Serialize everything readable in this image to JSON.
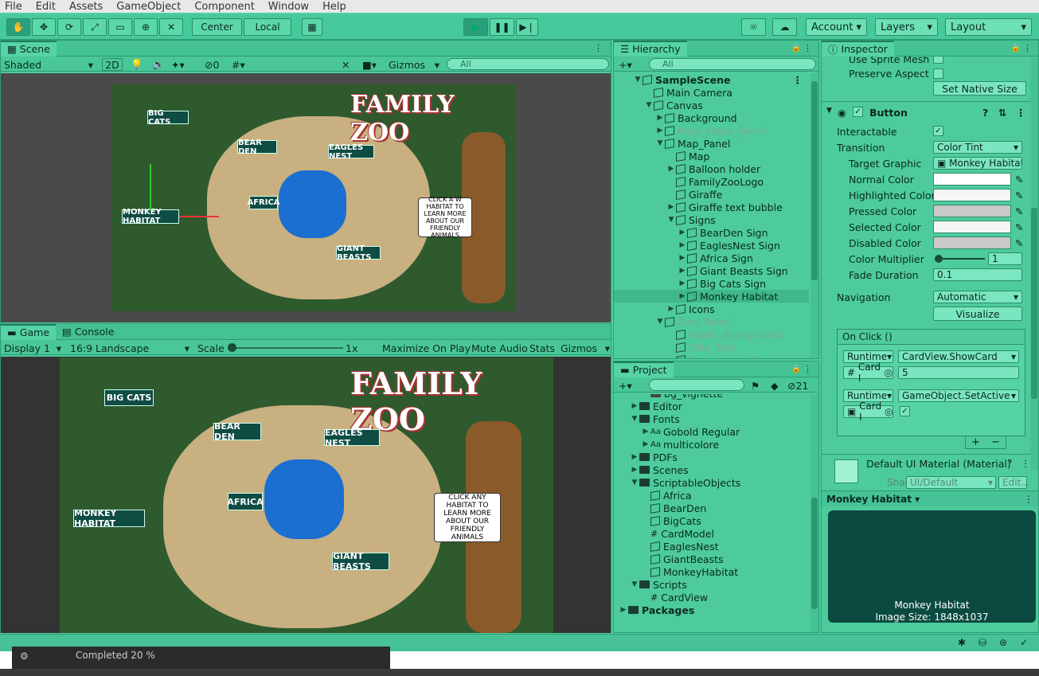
{
  "menu": [
    "File",
    "Edit",
    "Assets",
    "GameObject",
    "Component",
    "Window",
    "Help"
  ],
  "toolbar": {
    "center": "Center",
    "local": "Local",
    "account": "Account",
    "layers": "Layers",
    "layout": "Layout"
  },
  "scene": {
    "tab": "Scene",
    "shading": "Shaded",
    "mode2d": "2D",
    "hidden_count": "0",
    "gizmos": "Gizmos",
    "search_placeholder": "All",
    "map": {
      "title": "FAMILY ZOO",
      "bubble": "CLICK A W HABITAT TO LEARN MORE ABOUT OUR FRIENDLY ANIMALS",
      "signs": [
        "BIG CATS",
        "BEAR DEN",
        "EAGLES NEST",
        "AFRICA",
        "MONKEY HABITAT",
        "GIANT BEASTS"
      ]
    }
  },
  "game": {
    "tabs": [
      "Game",
      "Console"
    ],
    "display": "Display 1",
    "aspect": "16:9 Landscape",
    "scale_label": "Scale",
    "scale_value": "1x",
    "options": [
      "Maximize On Play",
      "Mute Audio",
      "Stats",
      "Gizmos"
    ],
    "map": {
      "title": "FAMILY ZOO",
      "bubble": "CLICK ANY HABITAT TO LEARN MORE ABOUT OUR FRIENDLY ANIMALS",
      "signs": [
        "BIG CATS",
        "BEAR DEN",
        "EAGLES NEST",
        "AFRICA",
        "MONKEY HABITAT",
        "GIANT BEASTS"
      ]
    }
  },
  "hierarchy": {
    "tab": "Hierarchy",
    "search_placeholder": "All",
    "rows": [
      {
        "label": "SampleScene",
        "arrow": "▼",
        "indent": 0,
        "kind": "scene",
        "dim": false
      },
      {
        "label": "Main Camera",
        "arrow": "",
        "indent": 1,
        "kind": "cube",
        "dim": false
      },
      {
        "label": "Canvas",
        "arrow": "▼",
        "indent": 1,
        "kind": "cube",
        "dim": false
      },
      {
        "label": "Background",
        "arrow": "▶",
        "indent": 2,
        "kind": "cube",
        "dim": false
      },
      {
        "label": "Main_Menu_Panel",
        "arrow": "▶",
        "indent": 2,
        "kind": "cube",
        "dim": true
      },
      {
        "label": "Map_Panel",
        "arrow": "▼",
        "indent": 2,
        "kind": "cube",
        "dim": false
      },
      {
        "label": "Map",
        "arrow": "",
        "indent": 3,
        "kind": "cube",
        "dim": false
      },
      {
        "label": "Balloon holder",
        "arrow": "▶",
        "indent": 3,
        "kind": "cube",
        "dim": false
      },
      {
        "label": "FamilyZooLogo",
        "arrow": "",
        "indent": 3,
        "kind": "cube",
        "dim": false
      },
      {
        "label": "Giraffe",
        "arrow": "",
        "indent": 3,
        "kind": "cube",
        "dim": false
      },
      {
        "label": "Giraffe text bubble",
        "arrow": "▶",
        "indent": 3,
        "kind": "cube",
        "dim": false
      },
      {
        "label": "Signs",
        "arrow": "▼",
        "indent": 3,
        "kind": "cube",
        "dim": false
      },
      {
        "label": "BearDen Sign",
        "arrow": "▶",
        "indent": 4,
        "kind": "cube",
        "dim": false
      },
      {
        "label": "EaglesNest Sign",
        "arrow": "▶",
        "indent": 4,
        "kind": "cube",
        "dim": false
      },
      {
        "label": "Africa Sign",
        "arrow": "▶",
        "indent": 4,
        "kind": "cube",
        "dim": false
      },
      {
        "label": "Giant Beasts Sign",
        "arrow": "▶",
        "indent": 4,
        "kind": "cube",
        "dim": false
      },
      {
        "label": "Big Cats Sign",
        "arrow": "▶",
        "indent": 4,
        "kind": "cube",
        "dim": false
      },
      {
        "label": "Monkey Habitat",
        "arrow": "▶",
        "indent": 4,
        "kind": "cube",
        "dim": false,
        "selected": true
      },
      {
        "label": "Icons",
        "arrow": "▶",
        "indent": 3,
        "kind": "cube",
        "dim": false
      },
      {
        "label": "Card Panel",
        "arrow": "▼",
        "indent": 2,
        "kind": "cube",
        "dim": true
      },
      {
        "label": "Static_Background",
        "arrow": "",
        "indent": 3,
        "kind": "cube",
        "dim": true
      },
      {
        "label": "Title_Text",
        "arrow": "",
        "indent": 3,
        "kind": "cube",
        "dim": true
      },
      {
        "label": "Description_Text",
        "arrow": "",
        "indent": 3,
        "kind": "cube",
        "dim": true
      }
    ]
  },
  "project": {
    "tab": "Project",
    "count": "21",
    "rows": [
      {
        "label": "bg_vignette",
        "arrow": "",
        "indent": 2,
        "kind": "img"
      },
      {
        "label": "Editor",
        "arrow": "▶",
        "indent": 1,
        "kind": "folder"
      },
      {
        "label": "Fonts",
        "arrow": "▼",
        "indent": 1,
        "kind": "folder"
      },
      {
        "label": "Gobold Regular",
        "arrow": "▶",
        "indent": 2,
        "kind": "font"
      },
      {
        "label": "multicolore",
        "arrow": "▶",
        "indent": 2,
        "kind": "font"
      },
      {
        "label": "PDFs",
        "arrow": "▶",
        "indent": 1,
        "kind": "folder"
      },
      {
        "label": "Scenes",
        "arrow": "▶",
        "indent": 1,
        "kind": "folder"
      },
      {
        "label": "ScriptableObjects",
        "arrow": "▼",
        "indent": 1,
        "kind": "folder"
      },
      {
        "label": "Africa",
        "arrow": "",
        "indent": 2,
        "kind": "so"
      },
      {
        "label": "BearDen",
        "arrow": "",
        "indent": 2,
        "kind": "so"
      },
      {
        "label": "BigCats",
        "arrow": "",
        "indent": 2,
        "kind": "so"
      },
      {
        "label": "CardModel",
        "arrow": "",
        "indent": 2,
        "kind": "script"
      },
      {
        "label": "EaglesNest",
        "arrow": "",
        "indent": 2,
        "kind": "so"
      },
      {
        "label": "GiantBeasts",
        "arrow": "",
        "indent": 2,
        "kind": "so"
      },
      {
        "label": "MonkeyHabitat",
        "arrow": "",
        "indent": 2,
        "kind": "so"
      },
      {
        "label": "Scripts",
        "arrow": "▼",
        "indent": 1,
        "kind": "folder"
      },
      {
        "label": "CardView",
        "arrow": "",
        "indent": 2,
        "kind": "script"
      },
      {
        "label": "Packages",
        "arrow": "▶",
        "indent": 0,
        "kind": "folder",
        "bold": true
      }
    ]
  },
  "inspector": {
    "tab": "Inspector",
    "use_sprite_mesh": "Use Sprite Mesh",
    "preserve_aspect": "Preserve Aspect",
    "set_native_size": "Set Native Size",
    "component": "Button",
    "interactable": "Interactable",
    "transition": "Transition",
    "transition_value": "Color Tint",
    "target_graphic": "Target Graphic",
    "target_graphic_value": "Monkey Habitat",
    "colors": [
      {
        "label": "Normal Color",
        "color": "#ffffff"
      },
      {
        "label": "Highlighted Color",
        "color": "#f5f5f5"
      },
      {
        "label": "Pressed Color",
        "color": "#c8c8c8"
      },
      {
        "label": "Selected Color",
        "color": "#f5f5f5"
      },
      {
        "label": "Disabled Color",
        "color": "#c8c8c8"
      }
    ],
    "color_multiplier": "Color Multiplier",
    "color_multiplier_value": "1",
    "fade_duration": "Fade Duration",
    "fade_duration_value": "0.1",
    "navigation": "Navigation",
    "navigation_value": "Automatic",
    "visualize": "Visualize",
    "onclick": "On Click ()",
    "events": [
      {
        "runtime": "Runtime",
        "method": "CardView.ShowCard",
        "target": "Card I",
        "arg": "5"
      },
      {
        "runtime": "Runtime",
        "method": "GameObject.SetActive",
        "target": "Card I",
        "arg": "✓"
      }
    ],
    "material": "Default UI Material (Material)",
    "shader_label": "Shader",
    "shader_value": "UI/Default",
    "edit": "Edit...",
    "preview_title": "Monkey Habitat",
    "preview_name": "Monkey Habitat",
    "preview_size": "Image Size: 1848x1037"
  },
  "status": {
    "progress_text": "Completed 20 %",
    "progress": 0.2
  }
}
